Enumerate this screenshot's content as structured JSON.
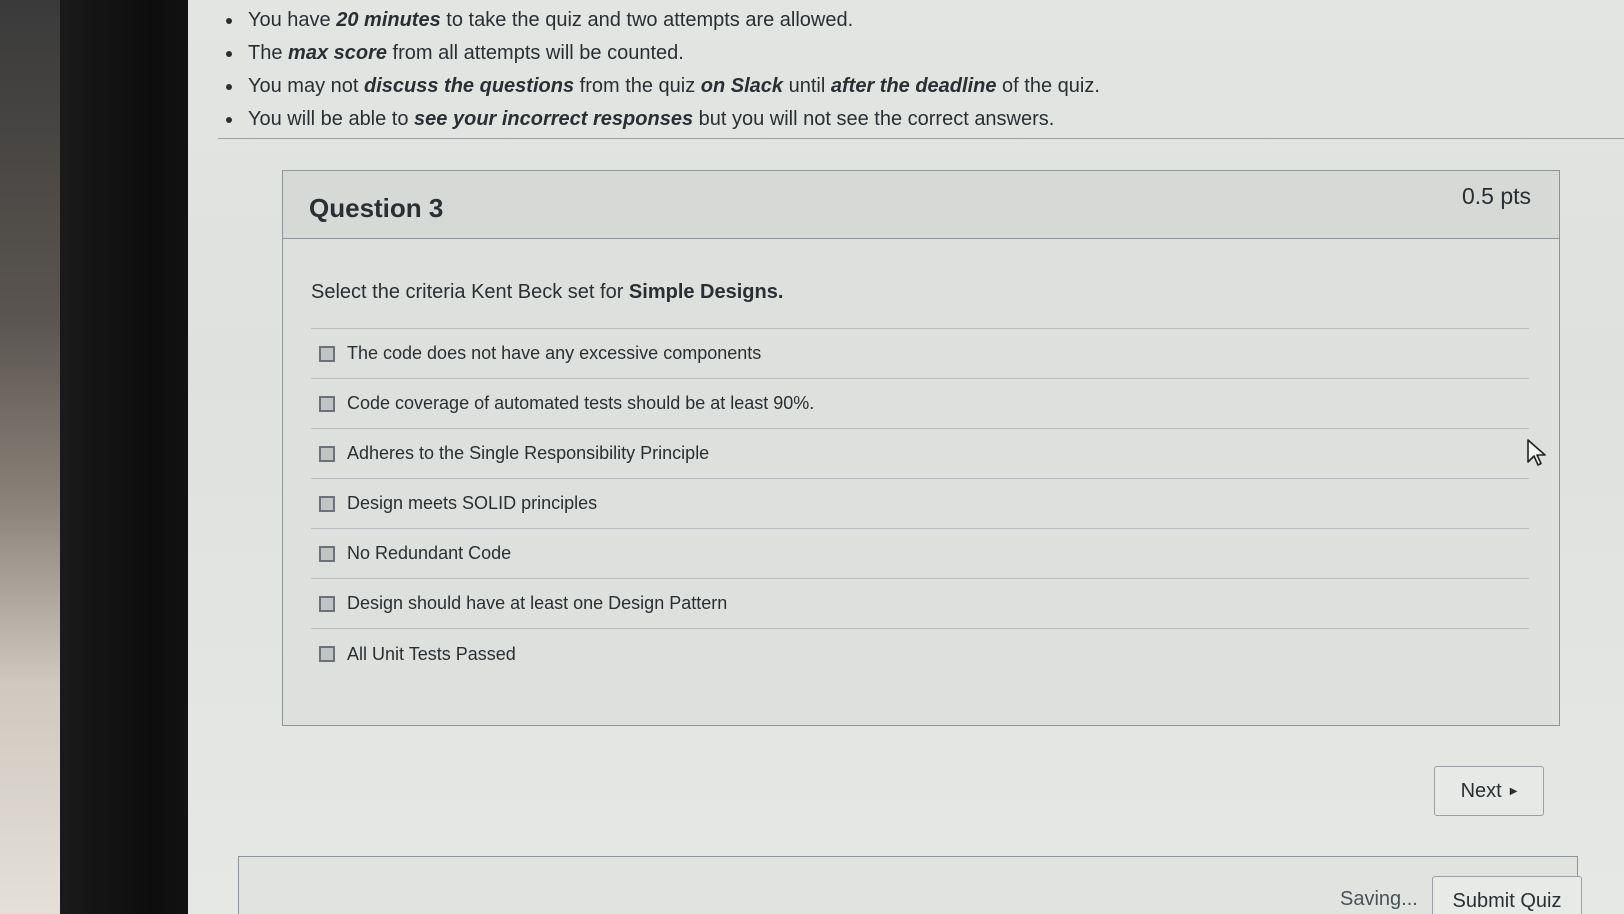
{
  "instructions": [
    {
      "parts": [
        {
          "t": "You have ",
          "s": ""
        },
        {
          "t": "20 minutes",
          "s": "bi"
        },
        {
          "t": " to take the quiz and two attempts are allowed.",
          "s": ""
        }
      ]
    },
    {
      "parts": [
        {
          "t": "The ",
          "s": ""
        },
        {
          "t": "max score",
          "s": "bi"
        },
        {
          "t": " from all attempts will be counted.",
          "s": ""
        }
      ]
    },
    {
      "parts": [
        {
          "t": "You may not ",
          "s": ""
        },
        {
          "t": "discuss the questions",
          "s": "bi"
        },
        {
          "t": " from the quiz ",
          "s": ""
        },
        {
          "t": "on Slack",
          "s": "bi"
        },
        {
          "t": " until ",
          "s": ""
        },
        {
          "t": "after the deadline",
          "s": "bi"
        },
        {
          "t": " of the quiz.",
          "s": ""
        }
      ]
    },
    {
      "parts": [
        {
          "t": "You will be able to ",
          "s": ""
        },
        {
          "t": "see your incorrect responses",
          "s": "bi"
        },
        {
          "t": " but you will not see the correct answers.",
          "s": ""
        }
      ]
    }
  ],
  "question": {
    "title": "Question 3",
    "points": "0.5 pts",
    "text_prefix": "Select the criteria Kent Beck set for ",
    "text_bold": "Simple Designs.",
    "answers": [
      {
        "label": "The code does not have any excessive components",
        "checked": false
      },
      {
        "label": "Code coverage of automated tests should be at least 90%.",
        "checked": false
      },
      {
        "label": "Adheres to the Single Responsibility Principle",
        "checked": false
      },
      {
        "label": "Design meets SOLID principles",
        "checked": false
      },
      {
        "label": "No Redundant Code",
        "checked": false
      },
      {
        "label": "Design should have at least one Design Pattern",
        "checked": false
      },
      {
        "label": "All Unit Tests Passed",
        "checked": false
      }
    ]
  },
  "navigation": {
    "next_label": "Next",
    "next_icon": "triangle-right-icon"
  },
  "footer": {
    "status": "Saving...",
    "submit_label": "Submit Quiz"
  }
}
